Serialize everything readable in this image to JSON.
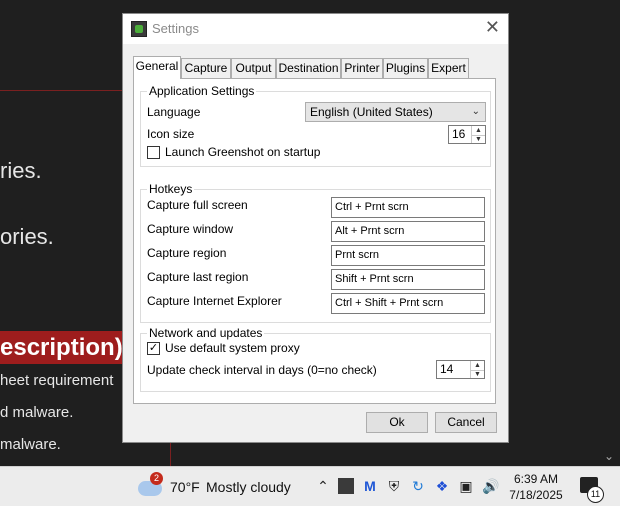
{
  "background": {
    "lines": [
      "ries.",
      "ories.",
      "escription)",
      "heet requirement",
      "d malware.",
      " malware."
    ],
    "heading_color": "#9e1d1d"
  },
  "dialog": {
    "title": "Settings",
    "tabs": [
      "General",
      "Capture",
      "Output",
      "Destination",
      "Printer",
      "Plugins",
      "Expert"
    ],
    "active_tab": "General",
    "app_settings": {
      "group_label": "Application Settings",
      "language_label": "Language",
      "language_value": "English (United States)",
      "icon_size_label": "Icon size",
      "icon_size_value": "16",
      "launch_label": "Launch Greenshot on startup",
      "launch_checked": false
    },
    "hotkeys": {
      "group_label": "Hotkeys",
      "rows": [
        {
          "label": "Capture full screen",
          "value": "Ctrl + Prnt scrn"
        },
        {
          "label": "Capture window",
          "value": "Alt + Prnt scrn"
        },
        {
          "label": "Capture region",
          "value": "Prnt scrn"
        },
        {
          "label": "Capture last region",
          "value": "Shift + Prnt scrn"
        },
        {
          "label": "Capture Internet Explorer",
          "value": "Ctrl + Shift + Prnt scrn"
        }
      ]
    },
    "network": {
      "group_label": "Network and updates",
      "proxy_label": "Use default system proxy",
      "proxy_checked": true,
      "interval_label": "Update check interval in days (0=no check)",
      "interval_value": "14"
    },
    "buttons": {
      "ok": "Ok",
      "cancel": "Cancel"
    }
  },
  "taskbar": {
    "weather_badge": "2",
    "temperature": "70°F",
    "condition": "Mostly cloudy",
    "time": "6:39 AM",
    "date": "7/18/2025",
    "notification_count": "11"
  }
}
